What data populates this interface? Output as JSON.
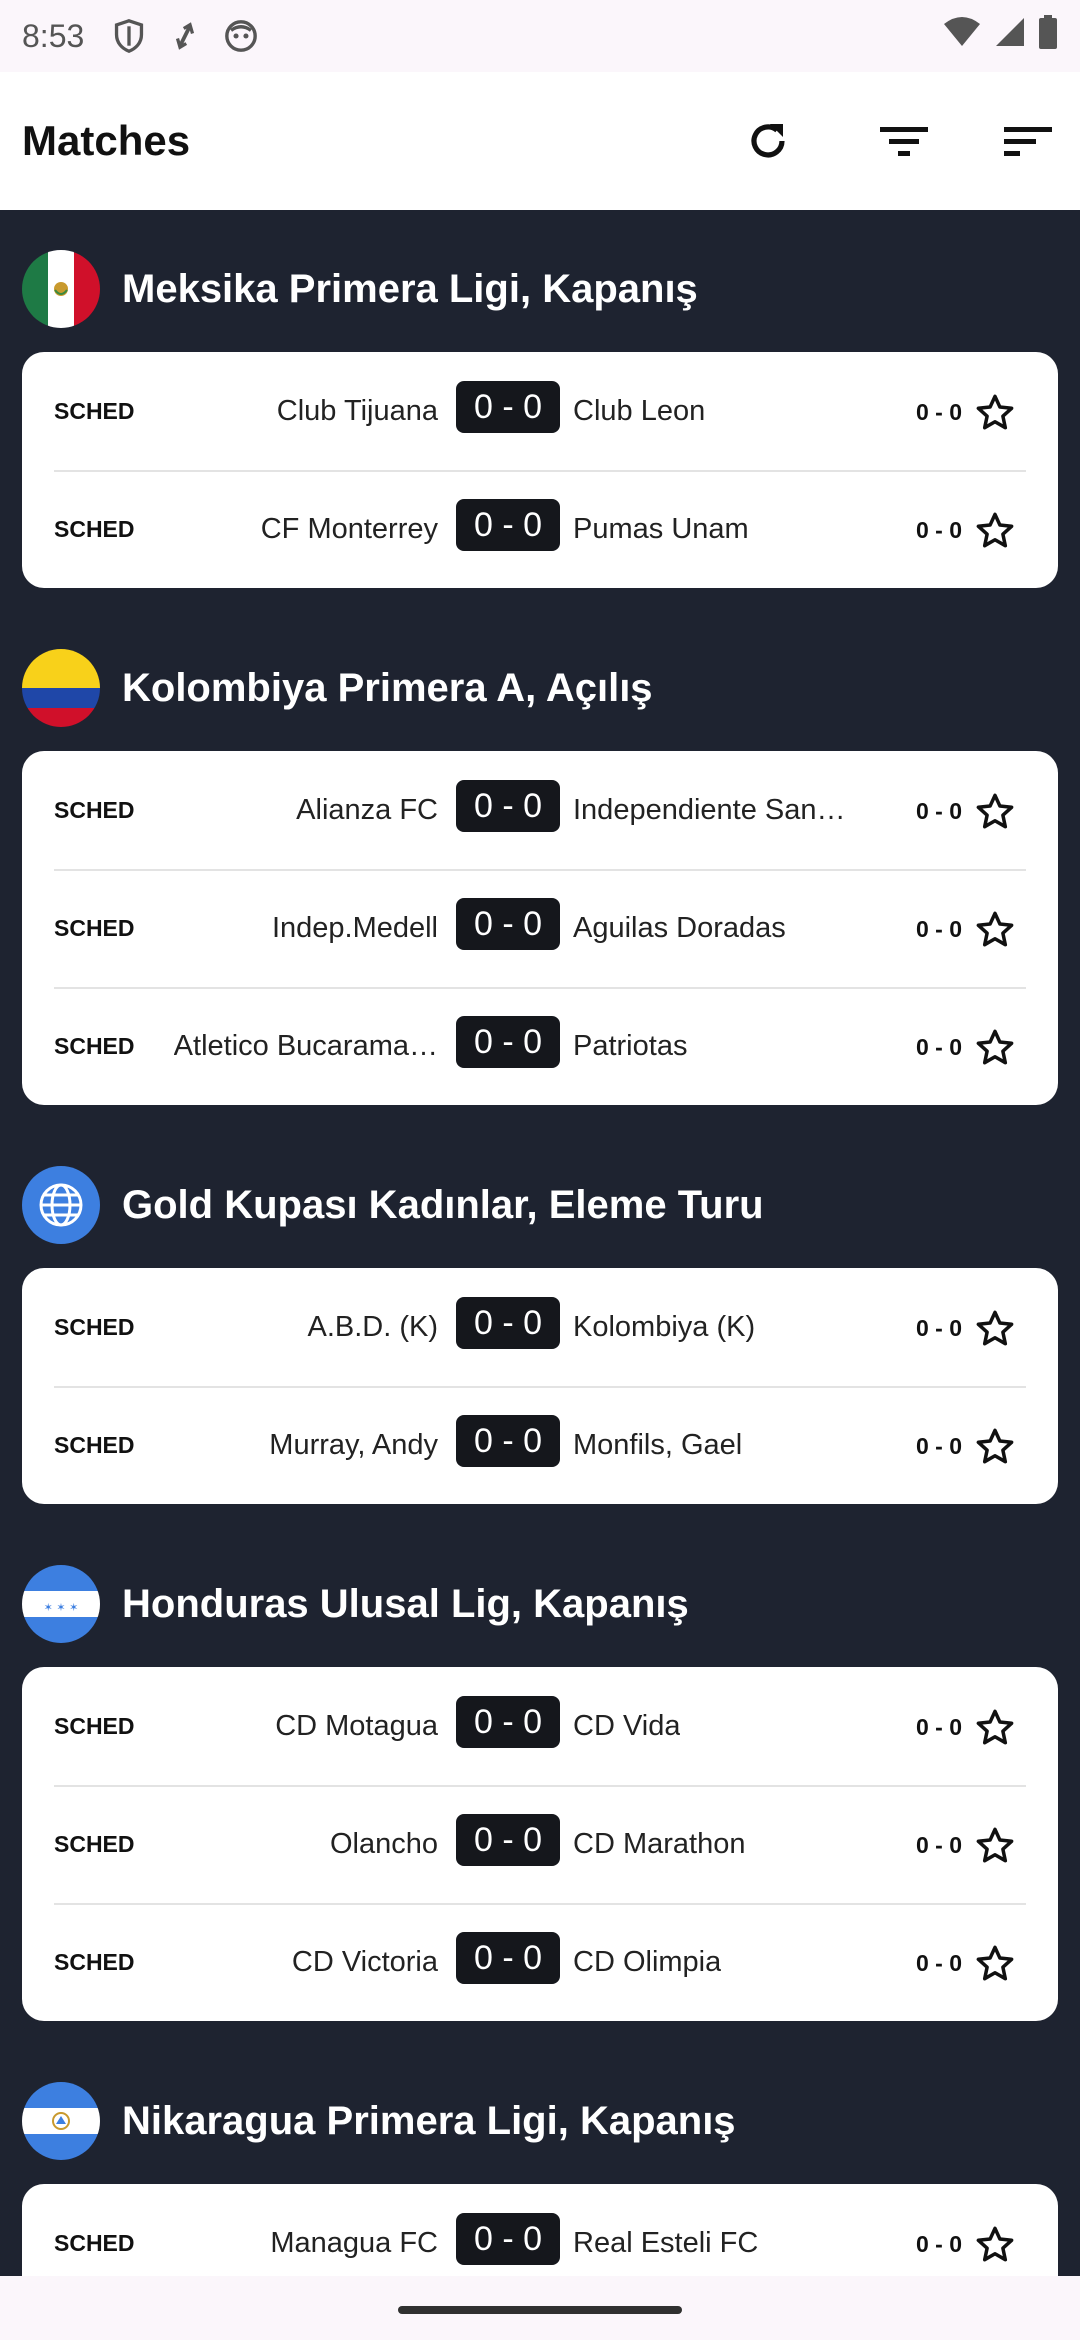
{
  "status_bar": {
    "time": "8:53"
  },
  "app_bar": {
    "title": "Matches"
  },
  "leagues": [
    {
      "name": "Meksika Primera Ligi, Kapanış",
      "flag": "mexico-flag",
      "matches": [
        {
          "status": "SCHED",
          "home": "Club Tijuana",
          "score": "0 - 0",
          "away": "Club Leon",
          "mini": "0 - 0"
        },
        {
          "status": "SCHED",
          "home": "CF Monterrey",
          "score": "0 - 0",
          "away": "Pumas Unam",
          "mini": "0 - 0"
        }
      ]
    },
    {
      "name": "Kolombiya Primera A, Açılış",
      "flag": "colombia-flag",
      "matches": [
        {
          "status": "SCHED",
          "home": "Alianza FC",
          "score": "0 - 0",
          "away": "Independiente San…",
          "mini": "0 - 0"
        },
        {
          "status": "SCHED",
          "home": "Indep.Medell",
          "score": "0 - 0",
          "away": "Aguilas Doradas",
          "mini": "0 - 0"
        },
        {
          "status": "SCHED",
          "home": "Atletico Bucarama…",
          "score": "0 - 0",
          "away": "Patriotas",
          "mini": "0 - 0"
        }
      ]
    },
    {
      "name": "Gold Kupası Kadınlar, Eleme Turu",
      "flag": "globe-icon",
      "matches": [
        {
          "status": "SCHED",
          "home": "A.B.D. (K)",
          "score": "0 - 0",
          "away": "Kolombiya (K)",
          "mini": "0 - 0"
        },
        {
          "status": "SCHED",
          "home": "Murray, Andy",
          "score": "0 - 0",
          "away": "Monfils, Gael",
          "mini": "0 - 0"
        }
      ]
    },
    {
      "name": "Honduras Ulusal Lig, Kapanış",
      "flag": "honduras-flag",
      "matches": [
        {
          "status": "SCHED",
          "home": "CD Motagua",
          "score": "0 - 0",
          "away": "CD Vida",
          "mini": "0 - 0"
        },
        {
          "status": "SCHED",
          "home": "Olancho",
          "score": "0 - 0",
          "away": "CD Marathon",
          "mini": "0 - 0"
        },
        {
          "status": "SCHED",
          "home": "CD Victoria",
          "score": "0 - 0",
          "away": "CD Olimpia",
          "mini": "0 - 0"
        }
      ]
    },
    {
      "name": "Nikaragua Primera Ligi, Kapanış",
      "flag": "nicaragua-flag",
      "matches": [
        {
          "status": "SCHED",
          "home": "Managua FC",
          "score": "0 - 0",
          "away": "Real Esteli FC",
          "mini": "0 - 0"
        }
      ]
    }
  ]
}
